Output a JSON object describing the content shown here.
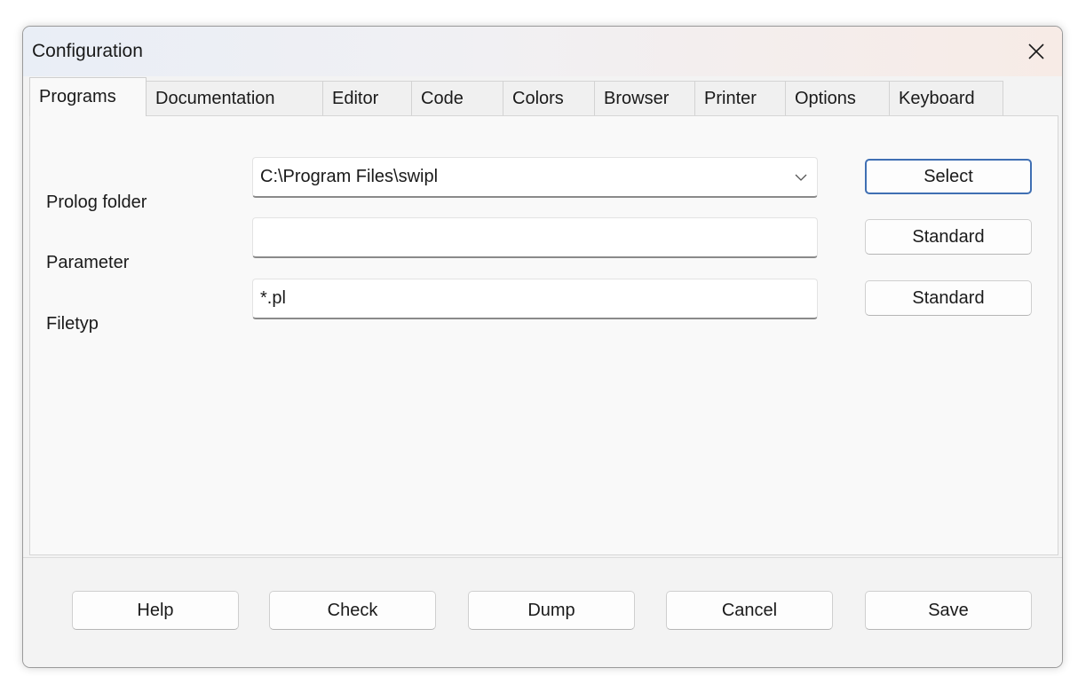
{
  "window": {
    "title": "Configuration"
  },
  "tabs": [
    {
      "label": "Programs",
      "active": true
    },
    {
      "label": "Documentation",
      "active": false
    },
    {
      "label": "Editor",
      "active": false
    },
    {
      "label": "Code",
      "active": false
    },
    {
      "label": "Colors",
      "active": false
    },
    {
      "label": "Browser",
      "active": false
    },
    {
      "label": "Printer",
      "active": false
    },
    {
      "label": "Options",
      "active": false
    },
    {
      "label": "Keyboard",
      "active": false
    }
  ],
  "programs": {
    "prolog_folder": {
      "label": "Prolog folder",
      "value": "C:\\Program Files\\swipl",
      "button": "Select"
    },
    "parameter": {
      "label": "Parameter",
      "value": "",
      "button": "Standard"
    },
    "filetyp": {
      "label": "Filetyp",
      "value": "*.pl",
      "button": "Standard"
    }
  },
  "footer": {
    "help": "Help",
    "check": "Check",
    "dump": "Dump",
    "cancel": "Cancel",
    "save": "Save"
  },
  "icons": {
    "close": "close-icon",
    "dropdown": "chevron-down-icon"
  },
  "colors": {
    "focus_border": "#3f6fb3",
    "window_bg": "#f3f3f3",
    "panel_bg": "#f9f9f9"
  }
}
